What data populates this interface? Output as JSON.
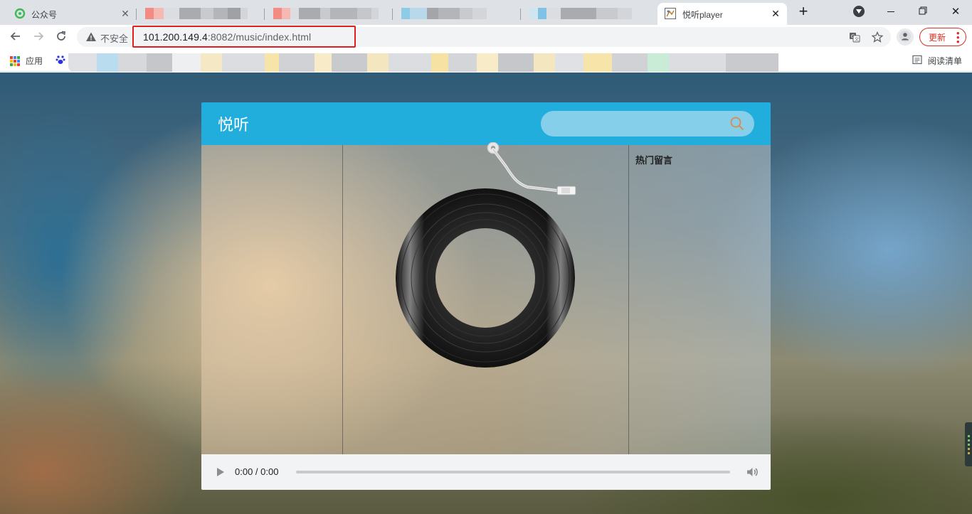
{
  "browser": {
    "tabs": [
      {
        "title": "公众号",
        "active": false
      },
      {
        "title": "",
        "active": false
      },
      {
        "title": "",
        "active": false
      },
      {
        "title": "",
        "active": false
      },
      {
        "title": "悦听player",
        "active": true
      }
    ],
    "new_tab_label": "+",
    "address_bar": {
      "security_label": "不安全",
      "url_host": "101.200.149.4",
      "url_rest": ":8082/music/index.html"
    },
    "update_button_label": "更新",
    "bookmarks": {
      "apps_label": "应用",
      "reading_list_label": "阅读清单"
    },
    "icons": {
      "back": "arrow-left-icon",
      "forward": "arrow-right-icon",
      "reload": "reload-icon",
      "warning": "warning-icon",
      "translate": "translate-icon",
      "bookmark_star": "star-icon",
      "profile": "profile-icon",
      "menu": "kebab-menu-icon"
    }
  },
  "app": {
    "logo": "悦听",
    "search": {
      "placeholder": "",
      "value": ""
    },
    "hot_comments_title": "热门留言",
    "player": {
      "time": "0:00 / 0:00",
      "progress": 0
    }
  },
  "colors": {
    "header": "#22aedc",
    "search_bg": "#85cfea",
    "update_red": "#d93025",
    "url_highlight": "#e02020"
  }
}
